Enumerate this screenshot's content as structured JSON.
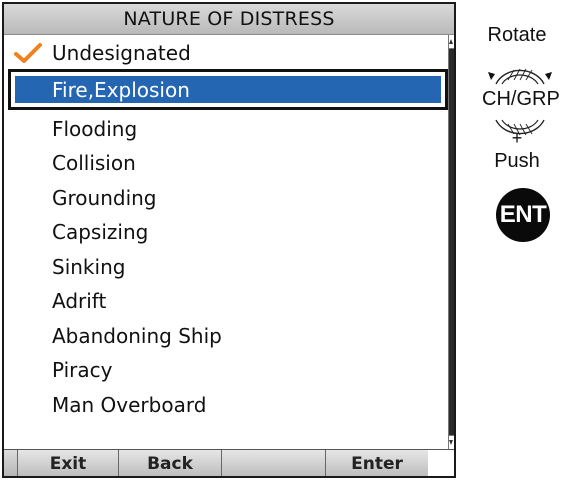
{
  "screen": {
    "title": "NATURE OF DISTRESS",
    "items": [
      {
        "label": "Undesignated",
        "checked": true,
        "selected": false
      },
      {
        "label": "Fire,Explosion",
        "checked": false,
        "selected": true
      },
      {
        "label": "Flooding",
        "checked": false,
        "selected": false
      },
      {
        "label": "Collision",
        "checked": false,
        "selected": false
      },
      {
        "label": "Grounding",
        "checked": false,
        "selected": false
      },
      {
        "label": "Capsizing",
        "checked": false,
        "selected": false
      },
      {
        "label": "Sinking",
        "checked": false,
        "selected": false
      },
      {
        "label": "Adrift",
        "checked": false,
        "selected": false
      },
      {
        "label": "Abandoning Ship",
        "checked": false,
        "selected": false
      },
      {
        "label": "Piracy",
        "checked": false,
        "selected": false
      },
      {
        "label": "Man Overboard",
        "checked": false,
        "selected": false
      }
    ],
    "softkeys": [
      "Exit",
      "Back",
      "",
      "Enter"
    ],
    "check_color": "#f0821e",
    "selection_color": "#2566b3"
  },
  "instructions": {
    "rotate": "Rotate",
    "knob_label": "CH/GRP",
    "plus": "+",
    "push": "Push",
    "ent_key": "ENT"
  }
}
